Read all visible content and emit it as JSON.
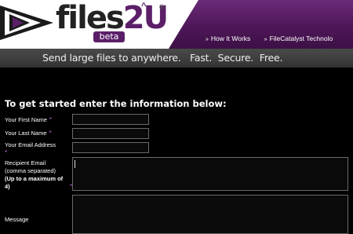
{
  "brand": {
    "logo_text_a": "files",
    "logo_text_b": "2U",
    "registered": "®",
    "beta_label": "beta",
    "colors": {
      "purple": "#5b1f68",
      "header_band": "#4e1758",
      "required_marker": "#b36ad0"
    }
  },
  "nav": {
    "items": [
      {
        "label": "How It Works",
        "icon": "double-chevron-right-icon"
      },
      {
        "label": "FileCatalyst Technolo",
        "icon": "double-chevron-right-icon"
      }
    ]
  },
  "tagline": "Send large files to anywhere.   Fast.  Secure.  Free.",
  "form": {
    "heading": "To get started enter the information below:",
    "required_marker": "*",
    "fields": {
      "first_name": {
        "label": "Your First Name",
        "value": ""
      },
      "last_name": {
        "label": "Your Last Name",
        "value": ""
      },
      "email": {
        "label": "Your Email Address",
        "value": ""
      },
      "recipient": {
        "label_line1": "Recipient Email",
        "label_line2": "(comma separated)",
        "label_bold": "(Up to a maximum of 4)",
        "value": ""
      },
      "message": {
        "label": "Message",
        "value": ""
      }
    }
  }
}
